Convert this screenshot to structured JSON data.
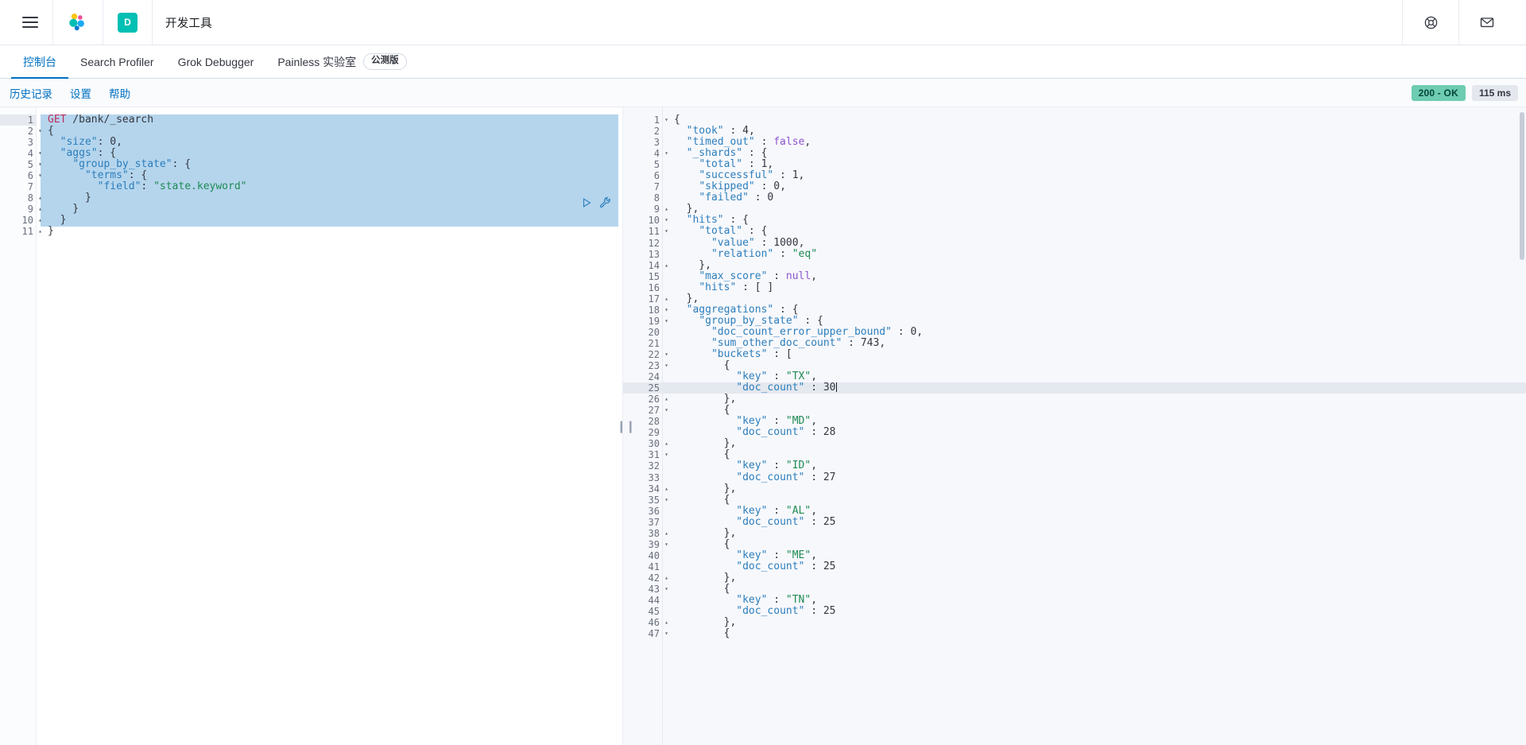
{
  "header": {
    "menu_icon": "hamburger-menu-icon",
    "logo_icon": "elastic-logo-icon",
    "space_initial": "D",
    "app_title": "开发工具",
    "help_icon": "help-lifebuoy-icon",
    "mail_icon": "envelope-icon"
  },
  "nav_tabs": [
    {
      "label": "控制台",
      "active": true,
      "badge": ""
    },
    {
      "label": "Search Profiler",
      "active": false,
      "badge": ""
    },
    {
      "label": "Grok Debugger",
      "active": false,
      "badge": ""
    },
    {
      "label": "Painless 实验室",
      "active": false,
      "badge": "公测版"
    }
  ],
  "subbar": {
    "links": [
      "历史记录",
      "设置",
      "帮助"
    ],
    "status": "200 - OK",
    "status_color": "#6DCCB1",
    "time": "115 ms"
  },
  "request_editor": {
    "play_icon": "play-triangle-icon",
    "wrench_icon": "wrench-icon",
    "lines": [
      {
        "n": 1,
        "fold": "",
        "tokens": [
          {
            "t": "GET",
            "c": "t-method"
          },
          {
            "t": " /bank/_search",
            "c": "t-url"
          }
        ]
      },
      {
        "n": 2,
        "fold": "▾",
        "tokens": [
          {
            "t": "{",
            "c": "t-punc"
          }
        ]
      },
      {
        "n": 3,
        "fold": "",
        "tokens": [
          {
            "t": "  ",
            "c": "t-plain"
          },
          {
            "t": "\"size\"",
            "c": "t-key"
          },
          {
            "t": ": ",
            "c": "t-punc"
          },
          {
            "t": "0",
            "c": "t-num"
          },
          {
            "t": ",",
            "c": "t-punc"
          }
        ]
      },
      {
        "n": 4,
        "fold": "▾",
        "tokens": [
          {
            "t": "  ",
            "c": "t-plain"
          },
          {
            "t": "\"aggs\"",
            "c": "t-key"
          },
          {
            "t": ": {",
            "c": "t-punc"
          }
        ]
      },
      {
        "n": 5,
        "fold": "▾",
        "tokens": [
          {
            "t": "    ",
            "c": "t-plain"
          },
          {
            "t": "\"group_by_state\"",
            "c": "t-key"
          },
          {
            "t": ": {",
            "c": "t-punc"
          }
        ]
      },
      {
        "n": 6,
        "fold": "▾",
        "tokens": [
          {
            "t": "      ",
            "c": "t-plain"
          },
          {
            "t": "\"terms\"",
            "c": "t-key"
          },
          {
            "t": ": {",
            "c": "t-punc"
          }
        ]
      },
      {
        "n": 7,
        "fold": "",
        "tokens": [
          {
            "t": "        ",
            "c": "t-plain"
          },
          {
            "t": "\"field\"",
            "c": "t-key"
          },
          {
            "t": ": ",
            "c": "t-punc"
          },
          {
            "t": "\"state.keyword\"",
            "c": "t-str"
          }
        ]
      },
      {
        "n": 8,
        "fold": "▴",
        "tokens": [
          {
            "t": "      }",
            "c": "t-punc"
          }
        ]
      },
      {
        "n": 9,
        "fold": "▴",
        "tokens": [
          {
            "t": "    }",
            "c": "t-punc"
          }
        ]
      },
      {
        "n": 10,
        "fold": "▴",
        "tokens": [
          {
            "t": "  }",
            "c": "t-punc"
          }
        ]
      },
      {
        "n": 11,
        "fold": "▴",
        "tokens": [
          {
            "t": "}",
            "c": "t-punc"
          }
        ]
      }
    ]
  },
  "response_editor": {
    "lines": [
      {
        "n": 1,
        "fold": "▾",
        "tokens": [
          {
            "t": "{",
            "c": "t-punc"
          }
        ]
      },
      {
        "n": 2,
        "fold": "",
        "tokens": [
          {
            "t": "  ",
            "c": "t-plain"
          },
          {
            "t": "\"took\"",
            "c": "t-key"
          },
          {
            "t": " : ",
            "c": "t-punc"
          },
          {
            "t": "4",
            "c": "t-num"
          },
          {
            "t": ",",
            "c": "t-punc"
          }
        ]
      },
      {
        "n": 3,
        "fold": "",
        "tokens": [
          {
            "t": "  ",
            "c": "t-plain"
          },
          {
            "t": "\"timed_out\"",
            "c": "t-key"
          },
          {
            "t": " : ",
            "c": "t-punc"
          },
          {
            "t": "false",
            "c": "t-bool"
          },
          {
            "t": ",",
            "c": "t-punc"
          }
        ]
      },
      {
        "n": 4,
        "fold": "▾",
        "tokens": [
          {
            "t": "  ",
            "c": "t-plain"
          },
          {
            "t": "\"_shards\"",
            "c": "t-key"
          },
          {
            "t": " : {",
            "c": "t-punc"
          }
        ]
      },
      {
        "n": 5,
        "fold": "",
        "tokens": [
          {
            "t": "    ",
            "c": "t-plain"
          },
          {
            "t": "\"total\"",
            "c": "t-key"
          },
          {
            "t": " : ",
            "c": "t-punc"
          },
          {
            "t": "1",
            "c": "t-num"
          },
          {
            "t": ",",
            "c": "t-punc"
          }
        ]
      },
      {
        "n": 6,
        "fold": "",
        "tokens": [
          {
            "t": "    ",
            "c": "t-plain"
          },
          {
            "t": "\"successful\"",
            "c": "t-key"
          },
          {
            "t": " : ",
            "c": "t-punc"
          },
          {
            "t": "1",
            "c": "t-num"
          },
          {
            "t": ",",
            "c": "t-punc"
          }
        ]
      },
      {
        "n": 7,
        "fold": "",
        "tokens": [
          {
            "t": "    ",
            "c": "t-plain"
          },
          {
            "t": "\"skipped\"",
            "c": "t-key"
          },
          {
            "t": " : ",
            "c": "t-punc"
          },
          {
            "t": "0",
            "c": "t-num"
          },
          {
            "t": ",",
            "c": "t-punc"
          }
        ]
      },
      {
        "n": 8,
        "fold": "",
        "tokens": [
          {
            "t": "    ",
            "c": "t-plain"
          },
          {
            "t": "\"failed\"",
            "c": "t-key"
          },
          {
            "t": " : ",
            "c": "t-punc"
          },
          {
            "t": "0",
            "c": "t-num"
          }
        ]
      },
      {
        "n": 9,
        "fold": "▴",
        "tokens": [
          {
            "t": "  },",
            "c": "t-punc"
          }
        ]
      },
      {
        "n": 10,
        "fold": "▾",
        "tokens": [
          {
            "t": "  ",
            "c": "t-plain"
          },
          {
            "t": "\"hits\"",
            "c": "t-key"
          },
          {
            "t": " : {",
            "c": "t-punc"
          }
        ]
      },
      {
        "n": 11,
        "fold": "▾",
        "tokens": [
          {
            "t": "    ",
            "c": "t-plain"
          },
          {
            "t": "\"total\"",
            "c": "t-key"
          },
          {
            "t": " : {",
            "c": "t-punc"
          }
        ]
      },
      {
        "n": 12,
        "fold": "",
        "tokens": [
          {
            "t": "      ",
            "c": "t-plain"
          },
          {
            "t": "\"value\"",
            "c": "t-key"
          },
          {
            "t": " : ",
            "c": "t-punc"
          },
          {
            "t": "1000",
            "c": "t-num"
          },
          {
            "t": ",",
            "c": "t-punc"
          }
        ]
      },
      {
        "n": 13,
        "fold": "",
        "tokens": [
          {
            "t": "      ",
            "c": "t-plain"
          },
          {
            "t": "\"relation\"",
            "c": "t-key"
          },
          {
            "t": " : ",
            "c": "t-punc"
          },
          {
            "t": "\"eq\"",
            "c": "t-str"
          }
        ]
      },
      {
        "n": 14,
        "fold": "▴",
        "tokens": [
          {
            "t": "    },",
            "c": "t-punc"
          }
        ]
      },
      {
        "n": 15,
        "fold": "",
        "tokens": [
          {
            "t": "    ",
            "c": "t-plain"
          },
          {
            "t": "\"max_score\"",
            "c": "t-key"
          },
          {
            "t": " : ",
            "c": "t-punc"
          },
          {
            "t": "null",
            "c": "t-null"
          },
          {
            "t": ",",
            "c": "t-punc"
          }
        ]
      },
      {
        "n": 16,
        "fold": "",
        "tokens": [
          {
            "t": "    ",
            "c": "t-plain"
          },
          {
            "t": "\"hits\"",
            "c": "t-key"
          },
          {
            "t": " : [ ]",
            "c": "t-punc"
          }
        ]
      },
      {
        "n": 17,
        "fold": "▴",
        "tokens": [
          {
            "t": "  },",
            "c": "t-punc"
          }
        ]
      },
      {
        "n": 18,
        "fold": "▾",
        "tokens": [
          {
            "t": "  ",
            "c": "t-plain"
          },
          {
            "t": "\"aggregations\"",
            "c": "t-key"
          },
          {
            "t": " : {",
            "c": "t-punc"
          }
        ]
      },
      {
        "n": 19,
        "fold": "▾",
        "tokens": [
          {
            "t": "    ",
            "c": "t-plain"
          },
          {
            "t": "\"group_by_state\"",
            "c": "t-key"
          },
          {
            "t": " : {",
            "c": "t-punc"
          }
        ]
      },
      {
        "n": 20,
        "fold": "",
        "tokens": [
          {
            "t": "      ",
            "c": "t-plain"
          },
          {
            "t": "\"doc_count_error_upper_bound\"",
            "c": "t-key"
          },
          {
            "t": " : ",
            "c": "t-punc"
          },
          {
            "t": "0",
            "c": "t-num"
          },
          {
            "t": ",",
            "c": "t-punc"
          }
        ]
      },
      {
        "n": 21,
        "fold": "",
        "tokens": [
          {
            "t": "      ",
            "c": "t-plain"
          },
          {
            "t": "\"sum_other_doc_count\"",
            "c": "t-key"
          },
          {
            "t": " : ",
            "c": "t-punc"
          },
          {
            "t": "743",
            "c": "t-num"
          },
          {
            "t": ",",
            "c": "t-punc"
          }
        ]
      },
      {
        "n": 22,
        "fold": "▾",
        "tokens": [
          {
            "t": "      ",
            "c": "t-plain"
          },
          {
            "t": "\"buckets\"",
            "c": "t-key"
          },
          {
            "t": " : [",
            "c": "t-punc"
          }
        ]
      },
      {
        "n": 23,
        "fold": "▾",
        "tokens": [
          {
            "t": "        {",
            "c": "t-punc"
          }
        ]
      },
      {
        "n": 24,
        "fold": "",
        "tokens": [
          {
            "t": "          ",
            "c": "t-plain"
          },
          {
            "t": "\"key\"",
            "c": "t-key"
          },
          {
            "t": " : ",
            "c": "t-punc"
          },
          {
            "t": "\"TX\"",
            "c": "t-str"
          },
          {
            "t": ",",
            "c": "t-punc"
          }
        ]
      },
      {
        "n": 25,
        "fold": "",
        "active": true,
        "caret": true,
        "tokens": [
          {
            "t": "          ",
            "c": "t-plain"
          },
          {
            "t": "\"doc_count\"",
            "c": "t-key"
          },
          {
            "t": " : ",
            "c": "t-punc"
          },
          {
            "t": "30",
            "c": "t-num"
          }
        ]
      },
      {
        "n": 26,
        "fold": "▴",
        "tokens": [
          {
            "t": "        },",
            "c": "t-punc"
          }
        ]
      },
      {
        "n": 27,
        "fold": "▾",
        "tokens": [
          {
            "t": "        {",
            "c": "t-punc"
          }
        ]
      },
      {
        "n": 28,
        "fold": "",
        "tokens": [
          {
            "t": "          ",
            "c": "t-plain"
          },
          {
            "t": "\"key\"",
            "c": "t-key"
          },
          {
            "t": " : ",
            "c": "t-punc"
          },
          {
            "t": "\"MD\"",
            "c": "t-str"
          },
          {
            "t": ",",
            "c": "t-punc"
          }
        ]
      },
      {
        "n": 29,
        "fold": "",
        "tokens": [
          {
            "t": "          ",
            "c": "t-plain"
          },
          {
            "t": "\"doc_count\"",
            "c": "t-key"
          },
          {
            "t": " : ",
            "c": "t-punc"
          },
          {
            "t": "28",
            "c": "t-num"
          }
        ]
      },
      {
        "n": 30,
        "fold": "▴",
        "tokens": [
          {
            "t": "        },",
            "c": "t-punc"
          }
        ]
      },
      {
        "n": 31,
        "fold": "▾",
        "tokens": [
          {
            "t": "        {",
            "c": "t-punc"
          }
        ]
      },
      {
        "n": 32,
        "fold": "",
        "tokens": [
          {
            "t": "          ",
            "c": "t-plain"
          },
          {
            "t": "\"key\"",
            "c": "t-key"
          },
          {
            "t": " : ",
            "c": "t-punc"
          },
          {
            "t": "\"ID\"",
            "c": "t-str"
          },
          {
            "t": ",",
            "c": "t-punc"
          }
        ]
      },
      {
        "n": 33,
        "fold": "",
        "tokens": [
          {
            "t": "          ",
            "c": "t-plain"
          },
          {
            "t": "\"doc_count\"",
            "c": "t-key"
          },
          {
            "t": " : ",
            "c": "t-punc"
          },
          {
            "t": "27",
            "c": "t-num"
          }
        ]
      },
      {
        "n": 34,
        "fold": "▴",
        "tokens": [
          {
            "t": "        },",
            "c": "t-punc"
          }
        ]
      },
      {
        "n": 35,
        "fold": "▾",
        "tokens": [
          {
            "t": "        {",
            "c": "t-punc"
          }
        ]
      },
      {
        "n": 36,
        "fold": "",
        "tokens": [
          {
            "t": "          ",
            "c": "t-plain"
          },
          {
            "t": "\"key\"",
            "c": "t-key"
          },
          {
            "t": " : ",
            "c": "t-punc"
          },
          {
            "t": "\"AL\"",
            "c": "t-str"
          },
          {
            "t": ",",
            "c": "t-punc"
          }
        ]
      },
      {
        "n": 37,
        "fold": "",
        "tokens": [
          {
            "t": "          ",
            "c": "t-plain"
          },
          {
            "t": "\"doc_count\"",
            "c": "t-key"
          },
          {
            "t": " : ",
            "c": "t-punc"
          },
          {
            "t": "25",
            "c": "t-num"
          }
        ]
      },
      {
        "n": 38,
        "fold": "▴",
        "tokens": [
          {
            "t": "        },",
            "c": "t-punc"
          }
        ]
      },
      {
        "n": 39,
        "fold": "▾",
        "tokens": [
          {
            "t": "        {",
            "c": "t-punc"
          }
        ]
      },
      {
        "n": 40,
        "fold": "",
        "tokens": [
          {
            "t": "          ",
            "c": "t-plain"
          },
          {
            "t": "\"key\"",
            "c": "t-key"
          },
          {
            "t": " : ",
            "c": "t-punc"
          },
          {
            "t": "\"ME\"",
            "c": "t-str"
          },
          {
            "t": ",",
            "c": "t-punc"
          }
        ]
      },
      {
        "n": 41,
        "fold": "",
        "tokens": [
          {
            "t": "          ",
            "c": "t-plain"
          },
          {
            "t": "\"doc_count\"",
            "c": "t-key"
          },
          {
            "t": " : ",
            "c": "t-punc"
          },
          {
            "t": "25",
            "c": "t-num"
          }
        ]
      },
      {
        "n": 42,
        "fold": "▴",
        "tokens": [
          {
            "t": "        },",
            "c": "t-punc"
          }
        ]
      },
      {
        "n": 43,
        "fold": "▾",
        "tokens": [
          {
            "t": "        {",
            "c": "t-punc"
          }
        ]
      },
      {
        "n": 44,
        "fold": "",
        "tokens": [
          {
            "t": "          ",
            "c": "t-plain"
          },
          {
            "t": "\"key\"",
            "c": "t-key"
          },
          {
            "t": " : ",
            "c": "t-punc"
          },
          {
            "t": "\"TN\"",
            "c": "t-str"
          },
          {
            "t": ",",
            "c": "t-punc"
          }
        ]
      },
      {
        "n": 45,
        "fold": "",
        "tokens": [
          {
            "t": "          ",
            "c": "t-plain"
          },
          {
            "t": "\"doc_count\"",
            "c": "t-key"
          },
          {
            "t": " : ",
            "c": "t-punc"
          },
          {
            "t": "25",
            "c": "t-num"
          }
        ]
      },
      {
        "n": 46,
        "fold": "▴",
        "tokens": [
          {
            "t": "        },",
            "c": "t-punc"
          }
        ]
      },
      {
        "n": 47,
        "fold": "▾",
        "tokens": [
          {
            "t": "        {",
            "c": "t-punc"
          }
        ]
      }
    ]
  }
}
